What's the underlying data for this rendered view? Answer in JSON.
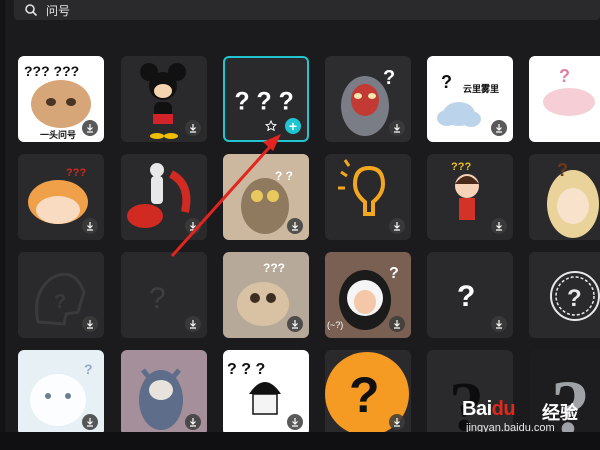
{
  "search": {
    "query": "问号",
    "icon": "search-icon"
  },
  "tiles": [
    {
      "id": "cat-meme",
      "caption": "一头问号",
      "marks": "??? ???"
    },
    {
      "id": "mickey",
      "caption": ""
    },
    {
      "id": "three-questions",
      "caption": "",
      "marks": "? ? ?",
      "selected": true,
      "actions": [
        "star-icon",
        "plus-icon"
      ]
    },
    {
      "id": "ultraman",
      "caption": "",
      "marks": "?"
    },
    {
      "id": "cloud",
      "caption": "云里雾里",
      "marks": "?"
    },
    {
      "id": "pink-blob",
      "caption": "",
      "marks": "?"
    },
    {
      "id": "girl-head",
      "caption": "",
      "marks": "???"
    },
    {
      "id": "figure-phone",
      "caption": ""
    },
    {
      "id": "owl",
      "caption": "",
      "marks": "? ?"
    },
    {
      "id": "bulb",
      "caption": ""
    },
    {
      "id": "doll-confused",
      "caption": "",
      "marks": "???"
    },
    {
      "id": "blonde-girl",
      "caption": "",
      "marks": "?"
    },
    {
      "id": "dark-head",
      "caption": "",
      "marks": "?"
    },
    {
      "id": "dark-question",
      "caption": "",
      "marks": "?"
    },
    {
      "id": "cat-2",
      "caption": "",
      "marks": "???"
    },
    {
      "id": "penguin-kid",
      "caption": "(~?)",
      "marks": "?"
    },
    {
      "id": "white-q",
      "caption": "",
      "marks": "?"
    },
    {
      "id": "circle-q",
      "caption": "",
      "marks": "?"
    },
    {
      "id": "white-bunny",
      "caption": "",
      "marks": "?"
    },
    {
      "id": "tom",
      "caption": ""
    },
    {
      "id": "bowl-cut",
      "caption": "",
      "marks": "? ? ?"
    },
    {
      "id": "orange-q",
      "caption": "",
      "marks": "?"
    },
    {
      "id": "black-q",
      "caption": "",
      "marks": "?"
    },
    {
      "id": "grey-q",
      "caption": "",
      "marks": "?"
    }
  ],
  "watermark": {
    "brand": "Bai",
    "brand_accent": "du",
    "cn": "经验",
    "url": "jingyan.baidu.com"
  },
  "colors": {
    "selected_border": "#22c4cf",
    "arrow": "#e3241f",
    "bg": "#1b1b1d"
  }
}
